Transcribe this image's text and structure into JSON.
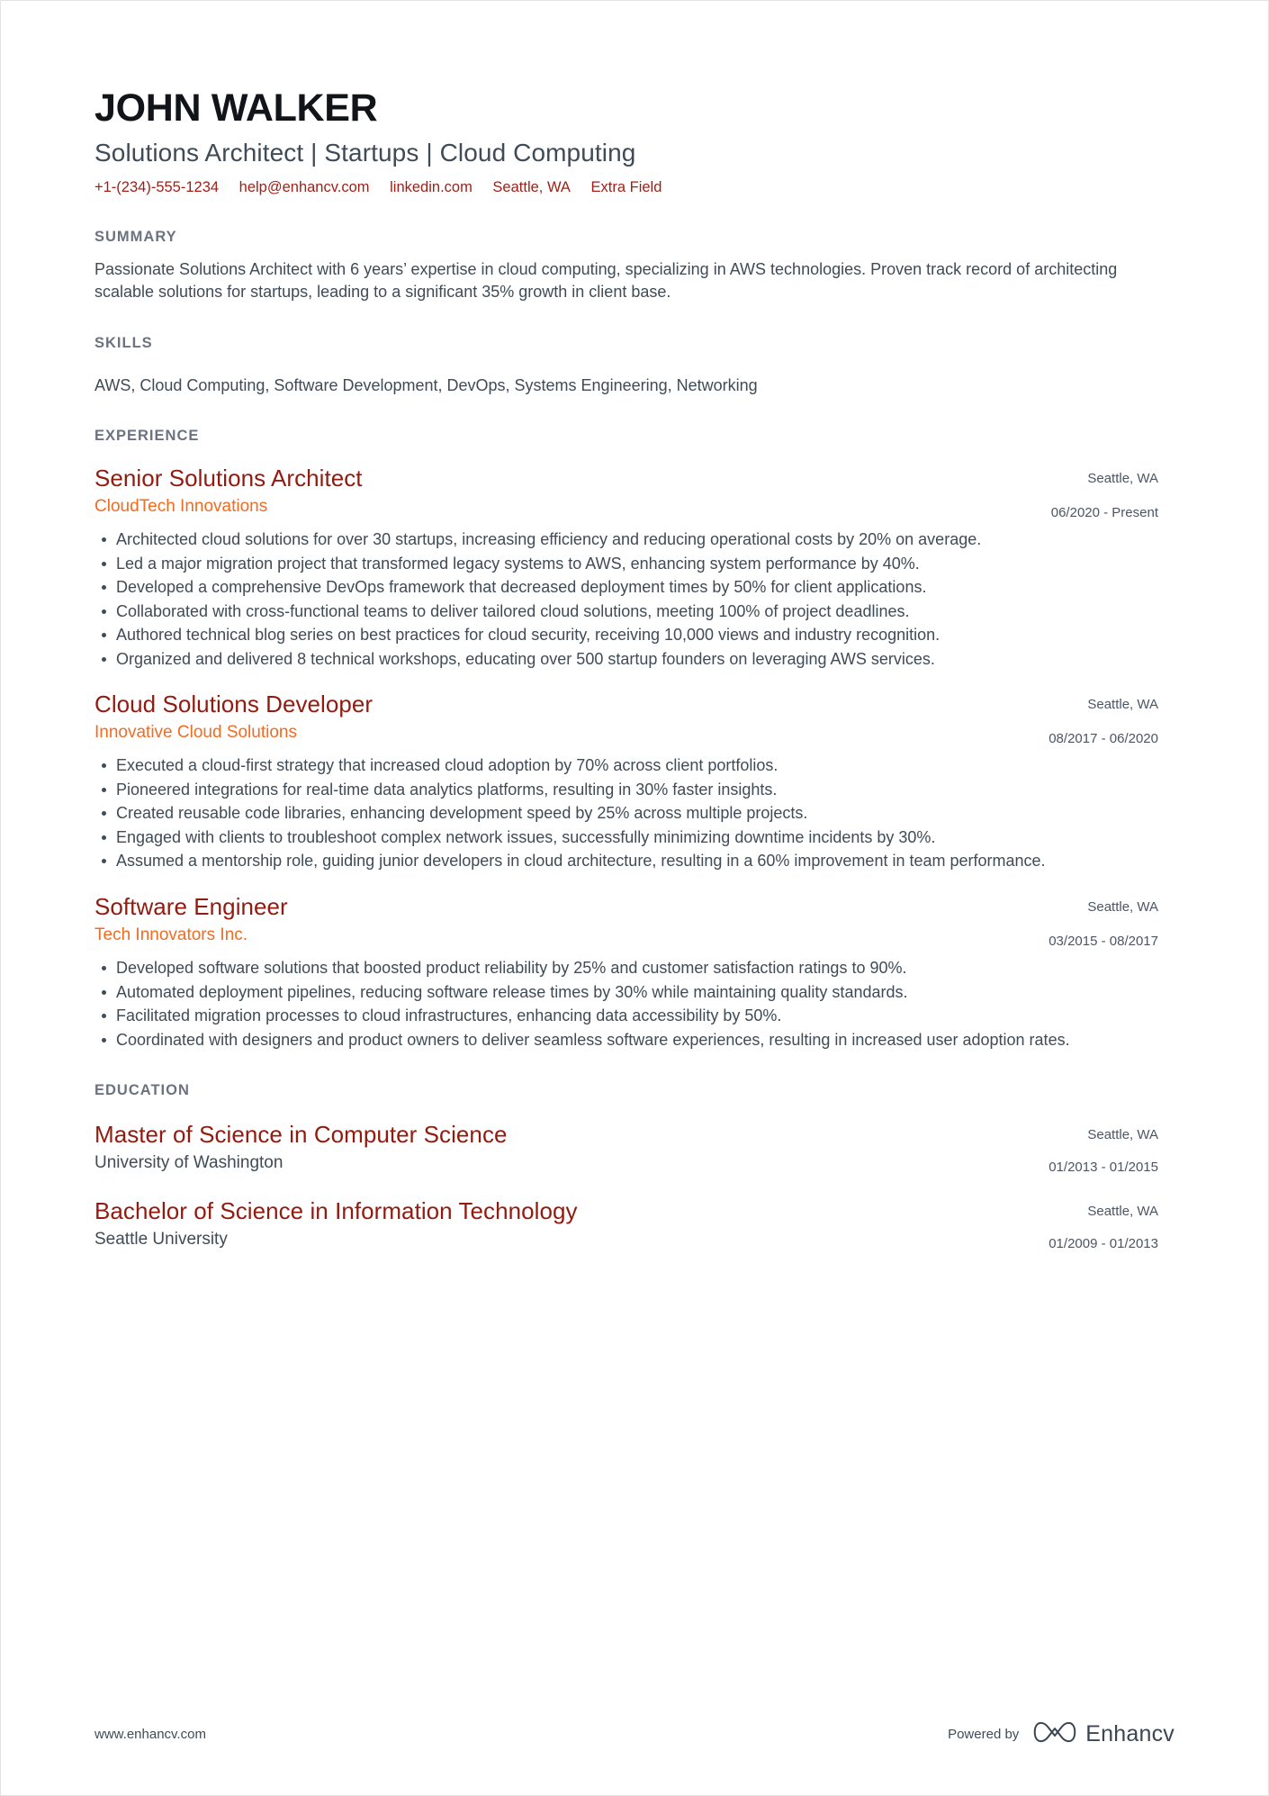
{
  "header": {
    "name": "JOHN WALKER",
    "headline": "Solutions Architect | Startups | Cloud Computing",
    "contacts": [
      {
        "name": "phone",
        "value": "+1-(234)-555-1234"
      },
      {
        "name": "email",
        "value": "help@enhancv.com"
      },
      {
        "name": "linkedin",
        "value": "linkedin.com"
      },
      {
        "name": "location",
        "value": "Seattle, WA"
      },
      {
        "name": "extra",
        "value": "Extra Field"
      }
    ]
  },
  "summary": {
    "title": "SUMMARY",
    "text": "Passionate Solutions Architect with 6 years’ expertise in cloud computing, specializing in AWS technologies. Proven track record of architecting scalable solutions for startups, leading to a significant 35% growth in client base."
  },
  "skills": {
    "title": "SKILLS",
    "list": "AWS, Cloud Computing, Software Development, DevOps, Systems Engineering, Networking"
  },
  "experience": {
    "title": "EXPERIENCE",
    "items": [
      {
        "role": "Senior Solutions Architect",
        "company": "CloudTech Innovations",
        "location": "Seattle, WA",
        "dates": "06/2020 - Present",
        "bullets": [
          "Architected cloud solutions for over 30 startups, increasing efficiency and reducing operational costs by 20% on average.",
          "Led a major migration project that transformed legacy systems to AWS, enhancing system performance by 40%.",
          "Developed a comprehensive DevOps framework that decreased deployment times by 50% for client applications.",
          "Collaborated with cross-functional teams to deliver tailored cloud solutions, meeting 100% of project deadlines.",
          "Authored technical blog series on best practices for cloud security, receiving 10,000 views and industry recognition.",
          "Organized and delivered 8 technical workshops, educating over 500 startup founders on leveraging AWS services."
        ]
      },
      {
        "role": "Cloud Solutions Developer",
        "company": "Innovative Cloud Solutions",
        "location": "Seattle, WA",
        "dates": "08/2017 - 06/2020",
        "bullets": [
          "Executed a cloud-first strategy that increased cloud adoption by 70% across client portfolios.",
          "Pioneered integrations for real-time data analytics platforms, resulting in 30% faster insights.",
          "Created reusable code libraries, enhancing development speed by 25% across multiple projects.",
          "Engaged with clients to troubleshoot complex network issues, successfully minimizing downtime incidents by 30%.",
          "Assumed a mentorship role, guiding junior developers in cloud architecture, resulting in a 60% improvement in team performance."
        ]
      },
      {
        "role": "Software Engineer",
        "company": "Tech Innovators Inc.",
        "location": "Seattle, WA",
        "dates": "03/2015 - 08/2017",
        "bullets": [
          "Developed software solutions that boosted product reliability by 25% and customer satisfaction ratings to 90%.",
          "Automated deployment pipelines, reducing software release times by 30% while maintaining quality standards.",
          "Facilitated migration processes to cloud infrastructures, enhancing data accessibility by 50%.",
          "Coordinated with designers and product owners to deliver seamless software experiences, resulting in increased user adoption rates."
        ]
      }
    ]
  },
  "education": {
    "title": "EDUCATION",
    "items": [
      {
        "degree": "Master of Science in Computer Science",
        "school": "University of Washington",
        "location": "Seattle, WA",
        "dates": "01/2013 - 01/2015"
      },
      {
        "degree": "Bachelor of Science in Information Technology",
        "school": "Seattle University",
        "location": "Seattle, WA",
        "dates": "01/2009 - 01/2013"
      }
    ]
  },
  "footer": {
    "url": "www.enhancv.com",
    "powered_by_label": "Powered by",
    "brand_name": "Enhancv",
    "brand_icon": "enhancv-infinity-logo"
  },
  "colors": {
    "accent_title": "#921b10",
    "accent_company": "#f26b21",
    "contact_link": "#9d1f15",
    "section_label": "#6b7280",
    "body_text": "#3f4b56"
  }
}
